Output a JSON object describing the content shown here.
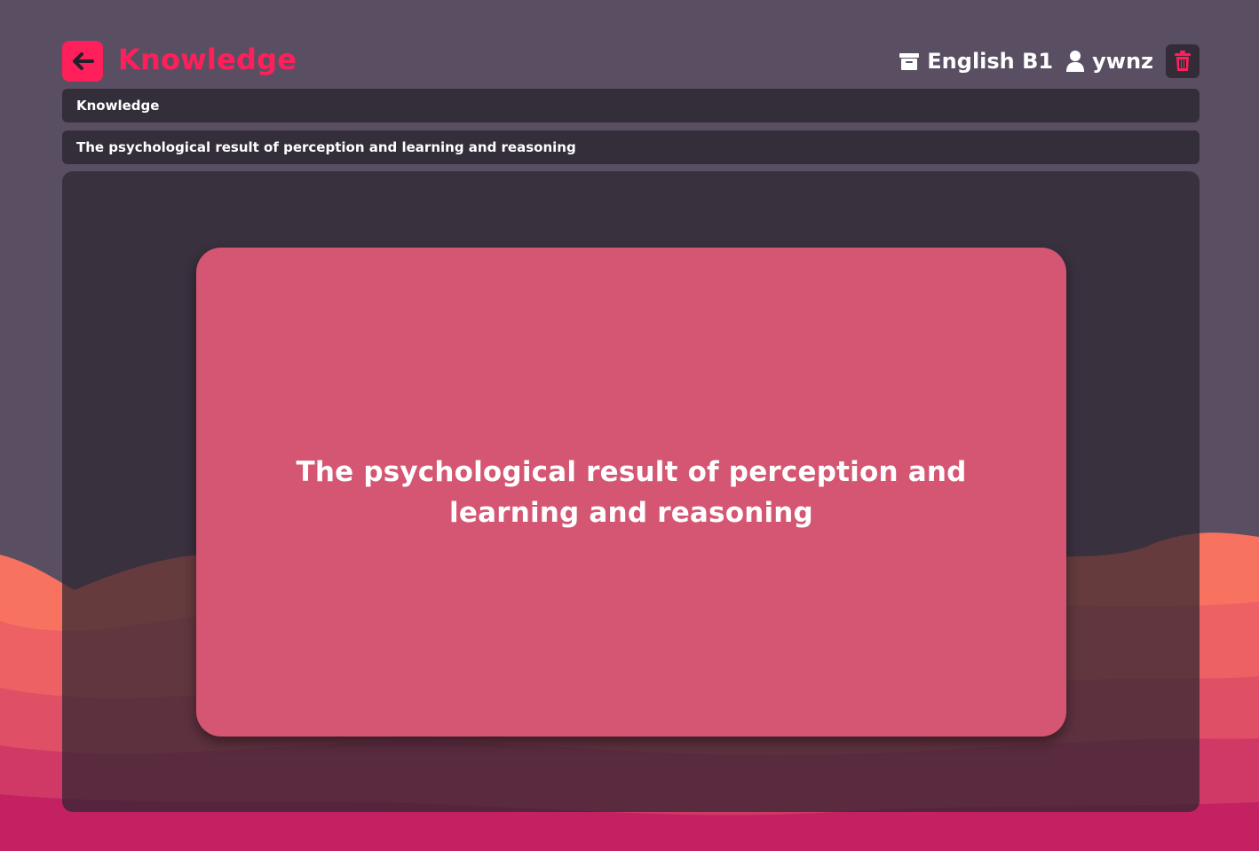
{
  "header": {
    "back_icon": "arrow-left-icon",
    "title": "Knowledge",
    "collection_icon": "archive-box-icon",
    "collection_name": "English B1",
    "user_icon": "user-icon",
    "username": "ywnz",
    "delete_icon": "trash-icon"
  },
  "bars": {
    "category": "Knowledge",
    "description": "The psychological result of perception and learning and reasoning"
  },
  "card": {
    "text": "The psychological result of perception and learning and reasoning"
  },
  "colors": {
    "page_background": "#5a4f62",
    "accent": "#ff1f5a",
    "panel": "#342d3a",
    "card": "#d45673",
    "wave_coral": "#f7735f",
    "wave_pink": "#c42163"
  }
}
